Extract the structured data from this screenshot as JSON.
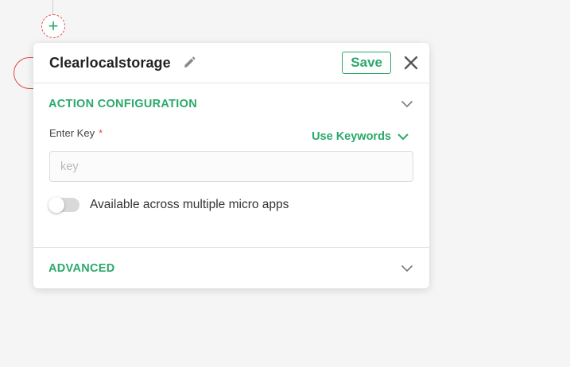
{
  "panel": {
    "title": "Clearlocalstorage",
    "save_label": "Save"
  },
  "action_configuration": {
    "title": "ACTION CONFIGURATION",
    "key_label": "Enter Key",
    "required_mark": "*",
    "keywords_label": "Use Keywords",
    "key_placeholder": "key",
    "key_value": "",
    "toggle_label": "Available across multiple micro apps",
    "toggle_on": false
  },
  "advanced": {
    "title": "ADVANCED"
  },
  "canvas": {
    "add_symbol": "+"
  },
  "colors": {
    "accent": "#2aa96a",
    "required": "#e04848",
    "node_border": "#e05252"
  },
  "icons": [
    "plus-icon",
    "pencil-icon",
    "close-icon",
    "chevron-down-icon"
  ]
}
